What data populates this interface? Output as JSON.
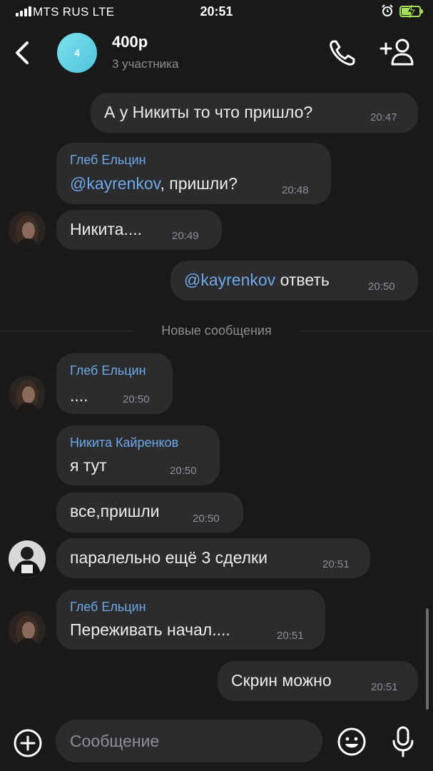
{
  "status_bar": {
    "carrier": "MTS RUS  LTE",
    "time": "20:51"
  },
  "header": {
    "avatar_text": "4",
    "title": "400р",
    "subtitle": "3 участника"
  },
  "messages": [
    {
      "side": "out",
      "text": "А у Никиты то что пришло?",
      "time": "20:47"
    },
    {
      "side": "in",
      "sender": "Глеб Ельцин",
      "mention": "@kayrenkov",
      "text": ", пришли?",
      "time": "20:48"
    },
    {
      "side": "in",
      "text": "Никита....",
      "time": "20:49",
      "avatar": "girl-avatar"
    },
    {
      "side": "out",
      "mention": "@kayrenkov",
      "text": " ответь",
      "time": "20:50"
    },
    {
      "side": "in",
      "sender": "Глеб Ельцин",
      "text": "....",
      "time": "20:50",
      "avatar": "girl-avatar"
    },
    {
      "side": "in",
      "sender": "Никита Кайренков",
      "text": "я тут",
      "time": "20:50"
    },
    {
      "side": "in",
      "text": "все,пришли",
      "time": "20:50"
    },
    {
      "side": "in",
      "text": "паралельно ещё 3 сделки",
      "time": "20:51",
      "avatar": "boy-avatar"
    },
    {
      "side": "in",
      "sender": "Глеб Ельцин",
      "text": "Переживать начал....",
      "time": "20:51",
      "avatar": "girl-avatar"
    },
    {
      "side": "out",
      "text": "Скрин можно",
      "time": "20:51"
    }
  ],
  "divider": "Новые сообщения",
  "input": {
    "placeholder": "Сообщение"
  },
  "colors": {
    "background": "#19191a",
    "bubble": "#2c2c2e",
    "accent": "#6ea8e8",
    "group_avatar": "#5fd0e2",
    "muted": "#8e8e93"
  }
}
